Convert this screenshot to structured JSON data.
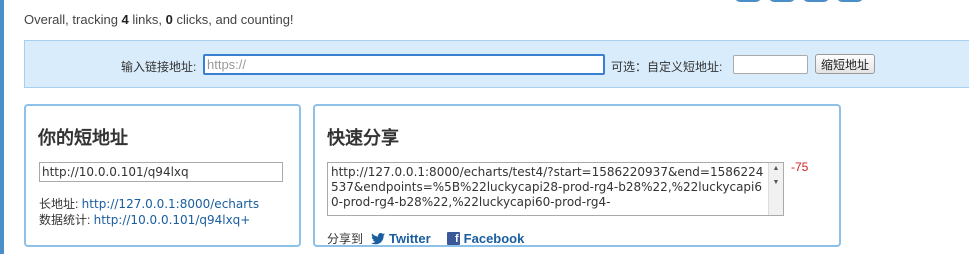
{
  "stats": {
    "prefix": "Overall, tracking ",
    "links": "4",
    "middle": " links, ",
    "clicks": "0",
    "suffix": " clicks, and counting!"
  },
  "form": {
    "url_label": "输入链接地址:",
    "url_value": "https://",
    "optional_label": "可选：自定义短地址:",
    "custom_value": "",
    "shorten_button": "缩短地址"
  },
  "short_panel": {
    "title": "你的短地址",
    "short_url": "http://10.0.0.101/q94lxq",
    "long_label": "长地址: ",
    "long_value": "http://127.0.0.1:8000/echarts",
    "stats_label": "数据统计: ",
    "stats_value": "http://10.0.0.101/q94lxq+"
  },
  "share_panel": {
    "title": "快速分享",
    "text": "http://127.0.0.1:8000/echarts/test4/?start=1586220937&end=1586224537&endpoints=%5B%22luckycapi28-prod-rg4-b28%22,%22luckycapi60-prod-rg4-b28%22,%22luckycapi60-prod-rg4-",
    "counter": "-75",
    "share_to": "分享到",
    "twitter": "Twitter",
    "facebook": "Facebook"
  },
  "colors": {
    "accent": "#4a8fc7",
    "panel_border": "#8ec1e8",
    "bar_bg": "#d9ecfb",
    "counter": "#cc2222",
    "link": "#1a5ea0"
  },
  "icons": [
    "twitter-bird-icon",
    "facebook-icon",
    "scroll-up-icon",
    "scroll-down-icon"
  ]
}
